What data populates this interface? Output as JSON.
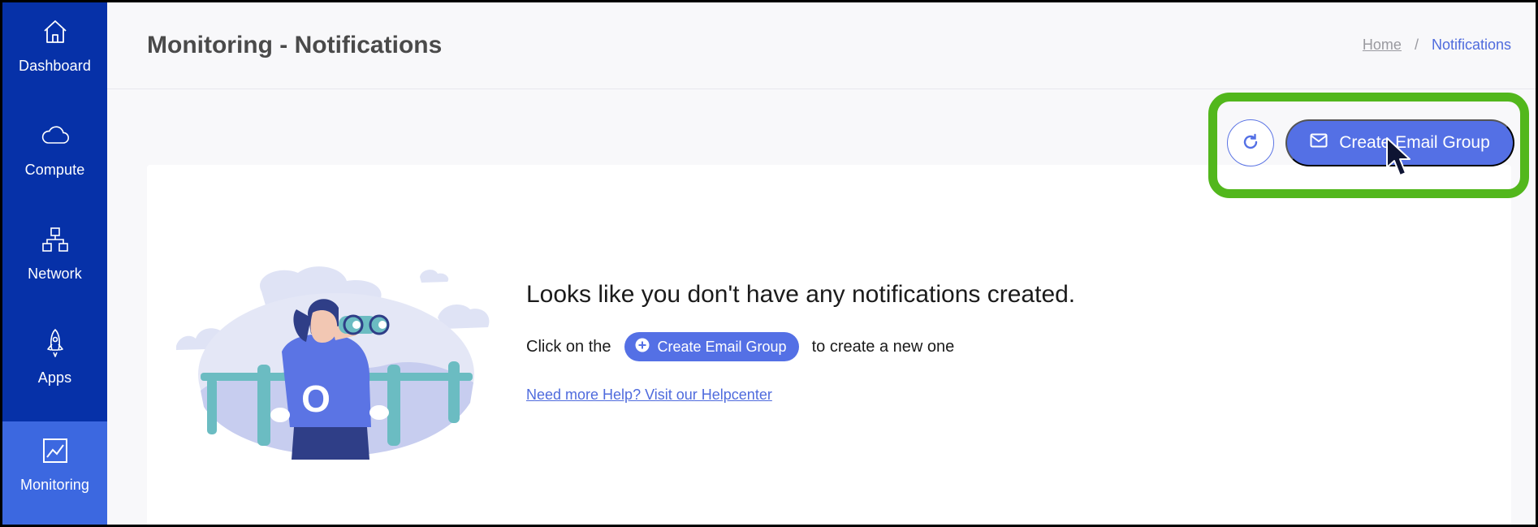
{
  "sidebar": {
    "items": [
      {
        "label": "Dashboard",
        "icon": "home-icon"
      },
      {
        "label": "Compute",
        "icon": "cloud-icon"
      },
      {
        "label": "Network",
        "icon": "network-icon"
      },
      {
        "label": "Apps",
        "icon": "rocket-icon"
      },
      {
        "label": "Monitoring",
        "icon": "chart-icon",
        "active": true
      }
    ]
  },
  "header": {
    "title": "Monitoring - Notifications",
    "breadcrumb": {
      "home": "Home",
      "separator": "/",
      "current": "Notifications"
    }
  },
  "toolbar": {
    "refresh_icon": "refresh-icon",
    "create_label": "Create Email Group",
    "create_icon": "mail-icon"
  },
  "empty_state": {
    "title": "Looks like you don't have any notifications created.",
    "hint_prefix": "Click on the",
    "hint_button": "Create Email Group",
    "hint_suffix": "to create a new one",
    "help_link": "Need more Help? Visit our Helpcenter",
    "illustration_letter": "O"
  },
  "colors": {
    "sidebar_bg": "#0631a8",
    "sidebar_active": "#3c68e0",
    "accent": "#5470e5",
    "highlight": "#52b71c"
  }
}
